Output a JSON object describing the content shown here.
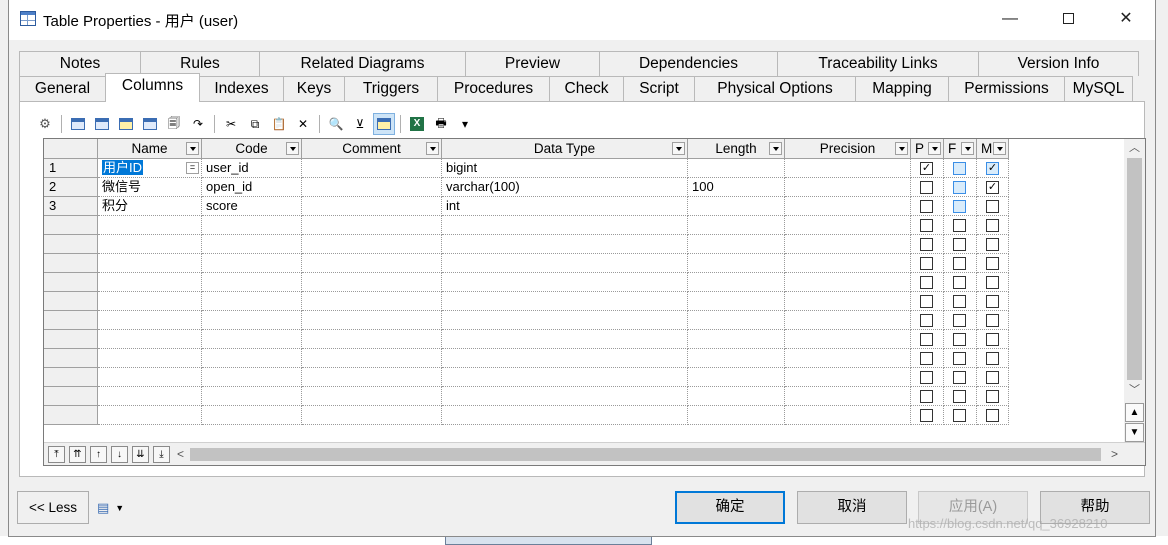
{
  "window": {
    "title": "Table Properties - 用户 (user)"
  },
  "title_buttons": {
    "minimize": "—",
    "close": "✕"
  },
  "tabs_top": [
    {
      "label": "Notes"
    },
    {
      "label": "Rules"
    },
    {
      "label": "Related Diagrams"
    },
    {
      "label": "Preview"
    },
    {
      "label": "Dependencies"
    },
    {
      "label": "Traceability Links"
    },
    {
      "label": "Version Info"
    }
  ],
  "tabs_bottom": [
    {
      "label": "General"
    },
    {
      "label": "Columns",
      "active": true
    },
    {
      "label": "Indexes"
    },
    {
      "label": "Keys"
    },
    {
      "label": "Triggers"
    },
    {
      "label": "Procedures"
    },
    {
      "label": "Check"
    },
    {
      "label": "Script"
    },
    {
      "label": "Physical Options"
    },
    {
      "label": "Mapping"
    },
    {
      "label": "Permissions"
    },
    {
      "label": "MySQL"
    }
  ],
  "toolbar": {
    "icons": [
      "properties-icon",
      "insert-row-icon",
      "add-row-icon",
      "add-columns-icon",
      "reuse-columns-icon",
      "paste-special-icon",
      "move-columns-icon",
      "cut-icon",
      "copy-icon",
      "paste-icon",
      "delete-icon",
      "find-icon",
      "filter-icon",
      "customize-columns-icon",
      "export-excel-icon",
      "print-icon",
      "dropdown-icon"
    ]
  },
  "grid": {
    "headers": [
      {
        "label": "Name"
      },
      {
        "label": "Code"
      },
      {
        "label": "Comment"
      },
      {
        "label": "Data Type"
      },
      {
        "label": "Length"
      },
      {
        "label": "Precision"
      },
      {
        "label": "P"
      },
      {
        "label": "F"
      },
      {
        "label": "M"
      }
    ],
    "rows": [
      {
        "num": "1",
        "name": "用户ID",
        "code": "user_id",
        "comment": "",
        "data_type": "bigint",
        "length": "",
        "precision": "",
        "p": true,
        "f": false,
        "m": true
      },
      {
        "num": "2",
        "name": "微信号",
        "code": "open_id",
        "comment": "",
        "data_type": "varchar(100)",
        "length": "100",
        "precision": "",
        "p": false,
        "f": false,
        "m": true
      },
      {
        "num": "3",
        "name": "积分",
        "code": "score",
        "comment": "",
        "data_type": "int",
        "length": "",
        "precision": "",
        "p": false,
        "f": false,
        "m": false
      }
    ],
    "empty_row_count": 11,
    "row_nav": [
      "move-top-icon",
      "move-page-up-icon",
      "move-up-icon",
      "move-down-icon",
      "move-page-down-icon",
      "move-bottom-icon"
    ]
  },
  "footer": {
    "less_label": "<< Less",
    "ok_label": "确定",
    "cancel_label": "取消",
    "apply_label": "应用(A)",
    "help_label": "帮助"
  },
  "watermark": "https://blog.csdn.net/qq_36928210",
  "colors": {
    "accent": "#0078d7",
    "selection": "#0078d7",
    "checkbox_blue": "#3a8ee6"
  }
}
